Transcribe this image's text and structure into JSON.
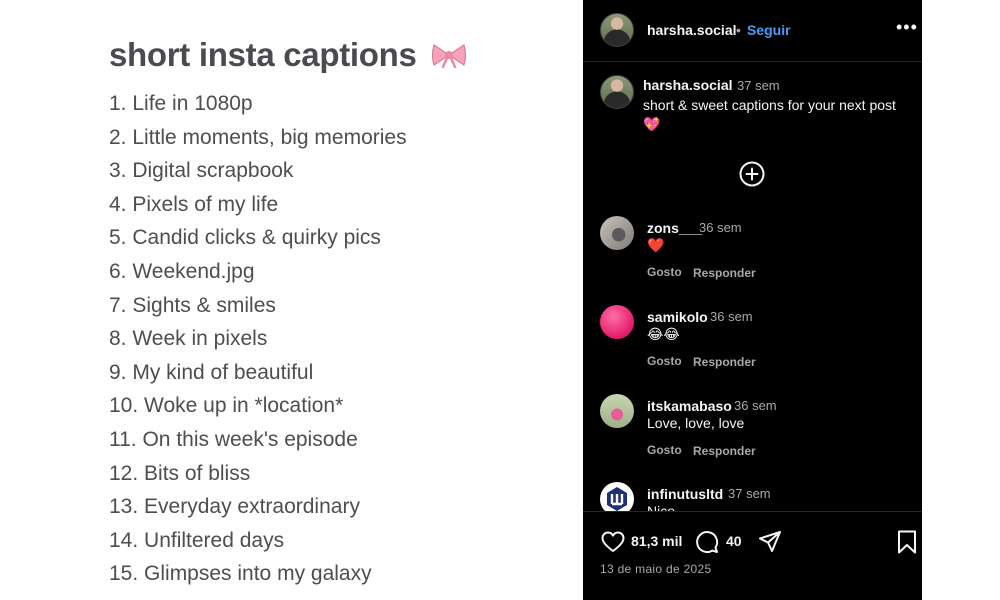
{
  "image": {
    "title": "short insta captions",
    "title_emoji": "🎀",
    "captions": [
      "1. Life in 1080p",
      "2. Little moments, big memories",
      "3. Digital scrapbook",
      "4. Pixels of my life",
      "5. Candid clicks & quirky pics",
      "6. Weekend.jpg",
      "7. Sights & smiles",
      "8. Week in pixels",
      "9. My kind of beautiful",
      "10. Woke up in *location*",
      "11. On this week's episode",
      "12. Bits of bliss",
      "13. Everyday extraordinary",
      "14. Unfiltered days",
      "15. Glimpses into my galaxy"
    ]
  },
  "post": {
    "header": {
      "username": "harsha.social",
      "separator": "•",
      "follow_label": "Seguir",
      "more_label": "•••"
    },
    "caption": {
      "username": "harsha.social",
      "time": "37 sem",
      "text": "short & sweet captions for your next post 💖"
    },
    "comments": [
      {
        "username": "zons___",
        "time": "36 sem",
        "text": "❤️",
        "like_label": "Gosto",
        "reply_label": "Responder"
      },
      {
        "username": "samikolo",
        "time": "36 sem",
        "text": "😂😂",
        "like_label": "Gosto",
        "reply_label": "Responder"
      },
      {
        "username": "itskamabaso",
        "time": "36 sem",
        "text": "Love, love, love",
        "like_label": "Gosto",
        "reply_label": "Responder"
      },
      {
        "username": "infinutusltd",
        "time": "37 sem",
        "text": "Nice"
      }
    ],
    "footer": {
      "likes": "81,3 mil",
      "comments_count": "40",
      "date": "13 de maio de 2025"
    }
  },
  "colors": {
    "panel_bg": "#000000",
    "link_blue": "#4a9cf5",
    "text_primary": "#f5f5f5",
    "text_secondary": "#a8a8a8",
    "caption_text": "#4d4d52"
  }
}
